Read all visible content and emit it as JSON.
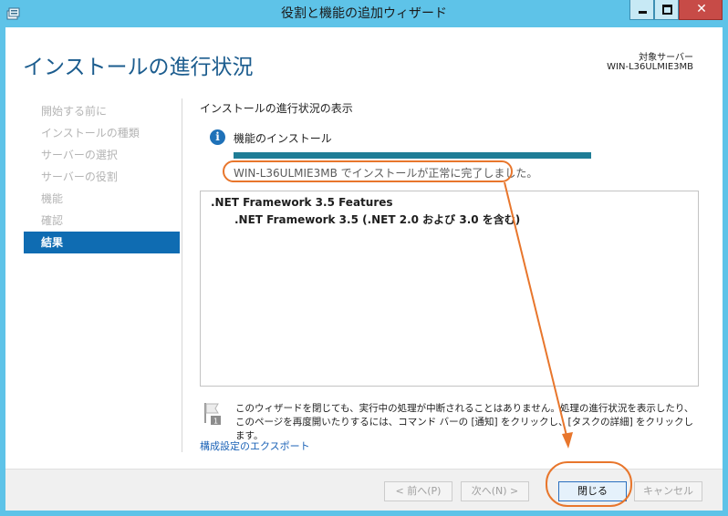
{
  "window": {
    "title": "役割と機能の追加ウィザード",
    "close_glyph": "✕"
  },
  "header": {
    "title": "インストールの進行状況",
    "destination_label": "対象サーバー",
    "destination_server": "WIN-L36ULMIE3MB"
  },
  "nav": {
    "items": [
      {
        "label": "開始する前に",
        "active": false
      },
      {
        "label": "インストールの種類",
        "active": false
      },
      {
        "label": "サーバーの選択",
        "active": false
      },
      {
        "label": "サーバーの役割",
        "active": false
      },
      {
        "label": "機能",
        "active": false
      },
      {
        "label": "確認",
        "active": false
      },
      {
        "label": "結果",
        "active": true
      }
    ]
  },
  "main": {
    "section_title": "インストールの進行状況の表示",
    "info_glyph": "i",
    "feature_install_label": "機能のインストール",
    "progress_fraction": 1.0,
    "status_text": "WIN-L36ULMIE3MB でインストールが正常に完了しました。",
    "results": {
      "line1": ".NET Framework 3.5 Features",
      "line2": ".NET Framework 3.5 (.NET 2.0 および 3.0 を含む)"
    },
    "note_text": "このウィザードを閉じても、実行中の処理が中断されることはありません。処理の進行状況を表示したり、このページを再度開いたりするには、コマンド バーの [通知] をクリックし、[タスクの詳細] をクリックします。",
    "export_link": "構成設定のエクスポート"
  },
  "footer": {
    "prev_label": "< 前へ(P)",
    "next_label": "次へ(N) >",
    "close_label": "閉じる",
    "cancel_label": "キャンセル"
  },
  "colors": {
    "titlebar": "#5ec3e8",
    "accent": "#0f6cb2",
    "progress": "#1f7d96",
    "annotation": "#e8762c",
    "link": "#1c63b7"
  }
}
